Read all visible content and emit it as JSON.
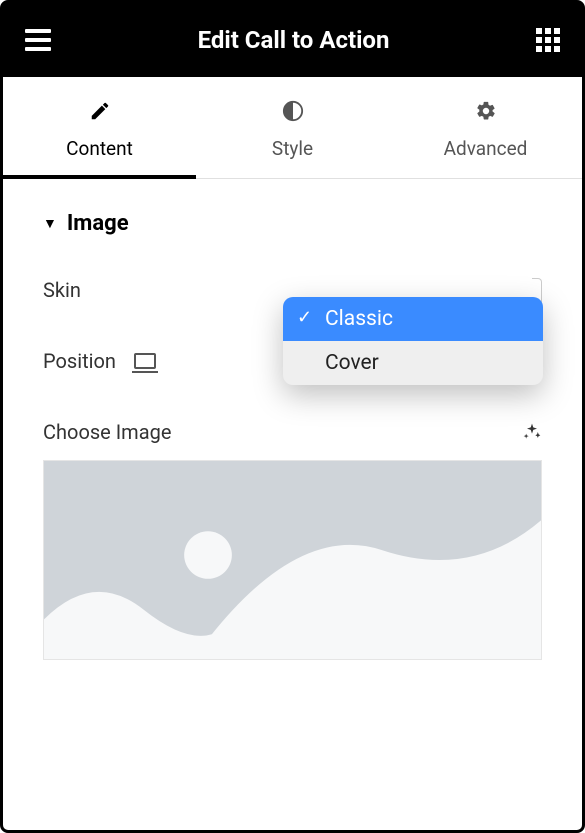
{
  "header": {
    "title": "Edit Call to Action"
  },
  "tabs": [
    {
      "label": "Content",
      "active": true
    },
    {
      "label": "Style",
      "active": false
    },
    {
      "label": "Advanced",
      "active": false
    }
  ],
  "section": {
    "title": "Image"
  },
  "skin": {
    "label": "Skin",
    "options": [
      "Classic",
      "Cover"
    ],
    "selected": "Classic"
  },
  "position": {
    "label": "Position"
  },
  "chooseImage": {
    "label": "Choose Image"
  }
}
